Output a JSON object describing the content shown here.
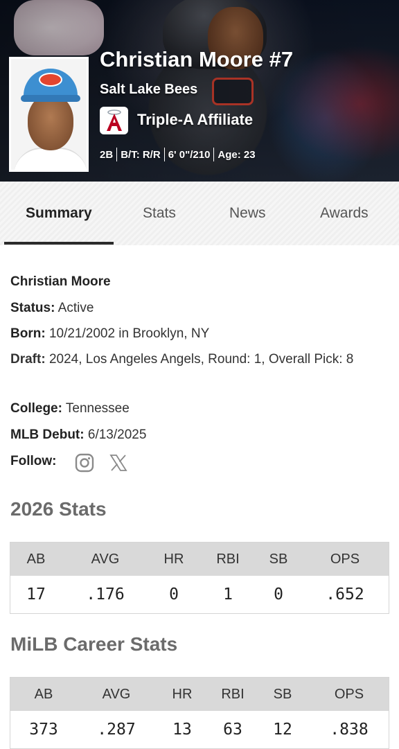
{
  "player": {
    "name_number": "Christian Moore #7",
    "team": "Salt Lake Bees",
    "affiliate": "Triple-A Affiliate",
    "meta": [
      "2B",
      "B/T: R/R",
      "6' 0\"/210",
      "Age: 23"
    ]
  },
  "tabs": [
    {
      "label": "Summary",
      "active": true
    },
    {
      "label": "Stats",
      "active": false
    },
    {
      "label": "News",
      "active": false
    },
    {
      "label": "Awards",
      "active": false
    }
  ],
  "bio": {
    "full_name": "Christian Moore",
    "status_label": "Status:",
    "status_value": "Active",
    "born_label": "Born:",
    "born_value": "10/21/2002 in Brooklyn, NY",
    "draft_label": "Draft:",
    "draft_value": "2024, Los Angeles Angels, Round: 1, Overall Pick: 8",
    "college_label": "College:",
    "college_value": "Tennessee",
    "debut_label": "MLB Debut:",
    "debut_value": "6/13/2025",
    "follow_label": "Follow:",
    "follow_icons": [
      "instagram-icon",
      "x-icon"
    ]
  },
  "season_stats": {
    "title": "2026 Stats",
    "headers": [
      "AB",
      "AVG",
      "HR",
      "RBI",
      "SB",
      "OPS"
    ],
    "values": [
      "17",
      ".176",
      "0",
      "1",
      "0",
      ".652"
    ]
  },
  "career_stats": {
    "title": "MiLB Career Stats",
    "headers": [
      "AB",
      "AVG",
      "HR",
      "RBI",
      "SB",
      "OPS"
    ],
    "values": [
      "373",
      ".287",
      "13",
      "63",
      "12",
      ".838"
    ]
  },
  "colors": {
    "angels_red": "#BA0021",
    "tab_underline": "#2b2b2b",
    "table_header_bg": "#d9d9d9"
  }
}
